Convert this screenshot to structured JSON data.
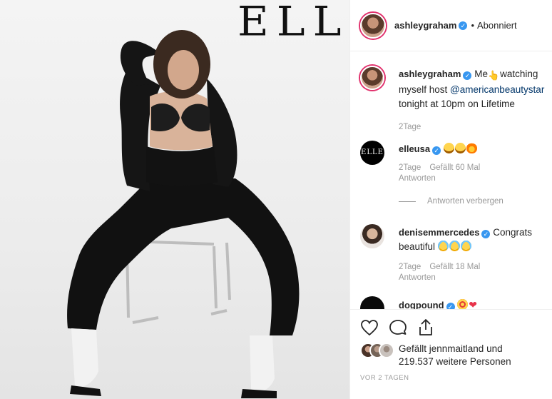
{
  "photo": {
    "magazine_logo": "ELLE"
  },
  "header": {
    "username": "ashleygraham",
    "separator": "•",
    "follow_status": "Abonniert"
  },
  "caption": {
    "username": "ashleygraham",
    "text_before": "Me",
    "text_after": "watching myself host",
    "mention": "@americanbeautystar",
    "text_end": "tonight at 10pm on Lifetime",
    "time": "2Tage"
  },
  "comments": [
    {
      "username": "elleusa",
      "avatar_text": "ELLE",
      "text": "",
      "emojis": [
        "laughing-emoji",
        "laughing-emoji",
        "fire-emoji"
      ],
      "time": "2Tage",
      "likes": "Gefällt 60 Mal",
      "reply": "Antworten"
    },
    {
      "username": "denisemmercedes",
      "text": "Congrats beautiful",
      "emojis": [
        "crying-emoji",
        "crying-emoji",
        "crying-emoji"
      ],
      "time": "2Tage",
      "likes": "Gefällt 18 Mal",
      "reply": "Antworten"
    },
    {
      "username": "dogpound",
      "text": "",
      "emojis": [
        "star-struck-emoji",
        "red-heart-emoji"
      ]
    }
  ],
  "hide_replies": "Antworten verbergen",
  "actions": {
    "like_icon": "heart-icon",
    "comment_icon": "comment-icon",
    "share_icon": "share-icon"
  },
  "likes": {
    "line1": "Gefällt jennmaitland und",
    "line2": "219.537 weitere Personen"
  },
  "timestamp": "VOR 2 TAGEN",
  "colors": {
    "verified": "#3897f0",
    "link": "#003569",
    "muted": "#999999",
    "story_ring": "#e1306c",
    "heart": "#e8334a"
  }
}
